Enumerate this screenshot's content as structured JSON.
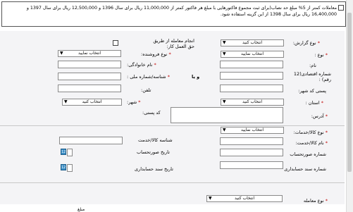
{
  "notice": {
    "text": "معاملات کمتر از 5% مبلغ حد نصاب(برای ثبت مجموع فاکتورهایی با مبلغ هر فاکتور کمتر از 11,000,000 ریال برای سال 1396 و 12,500,000 ریال برای سال 1397 و 16,400,000 ریال برای سال 1398 از این گزینه استفاده شود."
  },
  "form": {
    "report_type": {
      "label": "نوع گزارش:",
      "value": "انتخاب کنید"
    },
    "agent": {
      "label": "انجام معامله از طریق حق العمل کار:"
    },
    "type": {
      "label": "نوع :",
      "value": "انتخاب نمایید"
    },
    "seller_type": {
      "label": "نوع فروشنده:",
      "value": "انتخاب نمایید"
    },
    "name": {
      "label": "نام:"
    },
    "family": {
      "label": "نام خانوادگی:"
    },
    "economic_code": {
      "label": "شماره اقتصادی(12 رقم) :"
    },
    "national_id": {
      "label": "شناسه/شماره ملی :"
    },
    "and_or": "و یا",
    "postal_code": {
      "label": "پستی کد شهر:"
    },
    "phone": {
      "label": "تلفن:"
    },
    "province": {
      "label": "استان :",
      "value": "انتخاب کنید"
    },
    "city": {
      "label": "شهر:",
      "value": "انتخاب کنید"
    },
    "address": {
      "label": "آدرس:"
    },
    "postcode": {
      "label": "کد پستی:"
    },
    "goods_type": {
      "label": "نوع کالا/خدمات:",
      "value": "انتخاب نمایید"
    },
    "goods_name": {
      "label": "نام کالا/خدمت:"
    },
    "goods_id": {
      "label": "شناسه کالا/خدمت"
    },
    "invoice_no": {
      "label": "شماره صورتحساب"
    },
    "invoice_date": {
      "label": "تاریخ صورتحساب"
    },
    "doc_no": {
      "label": "شماره سند حسابداری"
    },
    "doc_date": {
      "label": "تاریخ سند حسابداری"
    },
    "deal_type": {
      "label": "نوع معامله",
      "value": "انتخاب کنید"
    }
  },
  "footer": {
    "fragment": "مبلغ"
  },
  "icons": {
    "calendar": "calendar-icon",
    "dropdown": "chevron-down-icon"
  }
}
